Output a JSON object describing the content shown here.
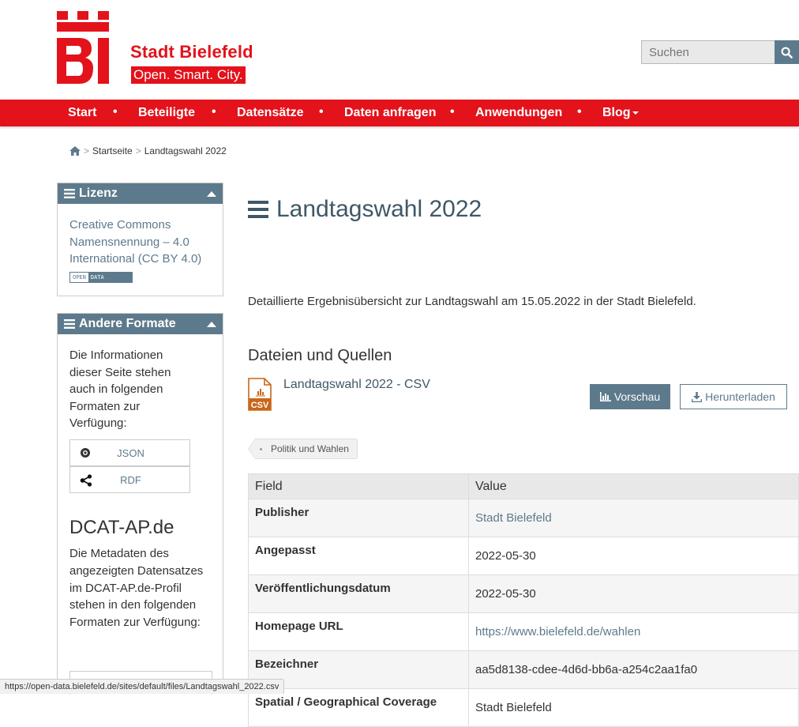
{
  "header": {
    "logo_text": "BI",
    "brand_title": "Stadt Bielefeld",
    "brand_tagline": "Open. Smart. City.",
    "search_placeholder": "Suchen",
    "brand_color": "#e3121b",
    "accent_color": "#5d7a8c"
  },
  "nav": {
    "items": [
      "Start",
      "Beteiligte",
      "Datensätze",
      "Daten anfragen",
      "Anwendungen",
      "Blog"
    ],
    "separator": "•"
  },
  "breadcrumb": {
    "home_icon": "home-icon",
    "separator": ">",
    "items": [
      "Startseite",
      "Landtagswahl 2022"
    ]
  },
  "sidebar": {
    "license": {
      "heading": "Lizenz",
      "text": "Creative Commons Namensnennung – 4.0 International (CC BY 4.0)",
      "badge_left": "OPEN",
      "badge_right": "DATA"
    },
    "formats": {
      "heading": "Andere Formate",
      "text": "Die Informationen dieser Seite stehen auch in folgenden Formaten zur Verfügung:",
      "buttons": [
        "JSON",
        "RDF"
      ]
    },
    "dcat": {
      "title": "DCAT-AP.de",
      "text": "Die Metadaten des angezeigten Datensatzes im DCAT-AP.de-Profil stehen in den folgenden Formaten zur Verfügung:"
    }
  },
  "main": {
    "title": "Landtagswahl 2022",
    "description": "Detaillierte Ergebnisübersicht zur Landtagswahl am 15.05.2022 in der Stadt Bielefeld.",
    "section_title": "Dateien und Quellen",
    "resource": {
      "name": "Landtagswahl 2022 - CSV",
      "format": "CSV",
      "preview_label": "Vorschau",
      "download_label": "Herunterladen"
    },
    "tag": "Politik und Wahlen",
    "table": {
      "headers": [
        "Field",
        "Value"
      ],
      "rows": [
        {
          "field": "Publisher",
          "value": "Stadt Bielefeld"
        },
        {
          "field": "Angepasst",
          "value": "2022-05-30"
        },
        {
          "field": "Veröffentlichungsdatum",
          "value": "2022-05-30"
        },
        {
          "field": "Homepage URL",
          "value": "https://www.bielefeld.de/wahlen"
        },
        {
          "field": "Bezeichner",
          "value": "aa5d8138-cdee-4d6d-bb6a-a254c2aa1fa0"
        },
        {
          "field": "Spatial / Geographical Coverage",
          "value": "Stadt Bielefeld"
        }
      ]
    }
  },
  "statusbar": {
    "url": "https://open-data.bielefeld.de/sites/default/files/Landtagswahl_2022.csv"
  }
}
